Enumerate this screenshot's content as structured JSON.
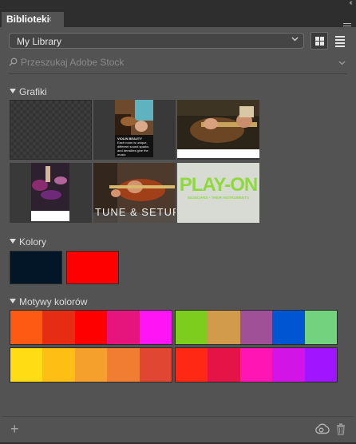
{
  "panel": {
    "tab_label": "Biblioteki CC",
    "tab_close": "×",
    "collapse": "‹‹",
    "menu_icon": "hamburger-icon"
  },
  "library": {
    "selected": "My Library"
  },
  "view": {
    "grid_icon": "grid-view-icon",
    "list_icon": "list-view-icon",
    "active": "grid"
  },
  "search": {
    "placeholder": "Przeszukaj Adobe Stock",
    "icon": "search-icon"
  },
  "sections": {
    "graphics": {
      "title": "Grafiki",
      "items": [
        {
          "kind": "transparent"
        },
        {
          "kind": "photo",
          "caption_title": "VIOLIN BEAUTY",
          "caption_text": "Each room is unique, different sound sparks and densities give the music"
        },
        {
          "kind": "photo"
        },
        {
          "kind": "photo"
        },
        {
          "kind": "photo",
          "overlay_text": "TUNE & SETUP"
        },
        {
          "kind": "logo",
          "logo_text": "PLAY-ON",
          "logo_sub": "MUSICIANS • THEIR INSTRUMENTS"
        }
      ]
    },
    "colors": {
      "title": "Kolory",
      "swatches": [
        "#021628",
        "#ff0000"
      ]
    },
    "themes": {
      "title": "Motywy kolorów",
      "items": [
        [
          "#ff5a14",
          "#e62d14",
          "#ff0000",
          "#e6147d",
          "#ff14f5"
        ],
        [
          "#7dcd1e",
          "#d29b4b",
          "#a05096",
          "#0055d2",
          "#73d27d"
        ],
        [
          "#ffdc14",
          "#ffbe14",
          "#f5a02d",
          "#f07d32",
          "#e14632"
        ],
        [
          "#ff2814",
          "#e61446",
          "#ff14b4",
          "#d214e6",
          "#a014ff"
        ]
      ]
    }
  },
  "bottom": {
    "add": "+",
    "cc_icon": "creative-cloud-icon",
    "trash_icon": "trash-icon"
  }
}
